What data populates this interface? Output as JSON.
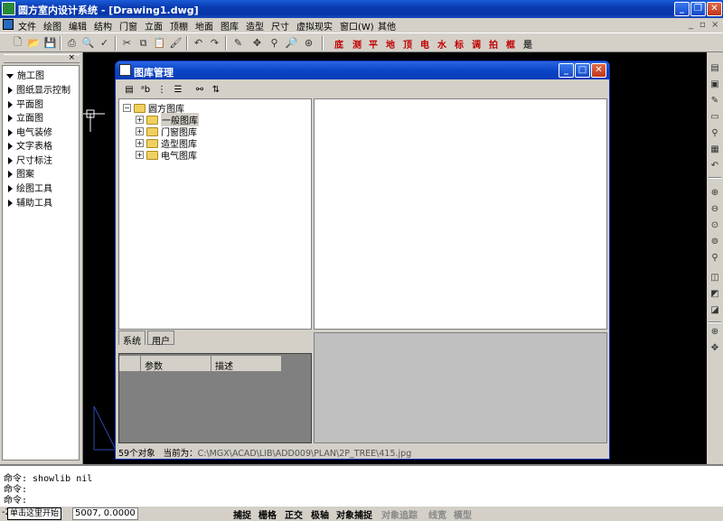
{
  "app": {
    "title": "圆方室内设计系统 - [Drawing1.dwg]"
  },
  "menu": {
    "items": [
      "文件",
      "绘图",
      "编辑",
      "结构",
      "门窗",
      "立面",
      "顶棚",
      "地面",
      "图库",
      "造型",
      "尺寸",
      "虚拟现实",
      "窗口(W)",
      "其他"
    ]
  },
  "toolbar": {
    "red_buttons": [
      "底",
      "测",
      "平",
      "地",
      "顶",
      "电",
      "水",
      "标",
      "调",
      "拍",
      "框",
      "是"
    ]
  },
  "left_panel": {
    "close_label": "×",
    "items": [
      "施工图",
      "图纸显示控制",
      "平面图",
      "立面图",
      "电气装修",
      "文字表格",
      "尺寸标注",
      "图案",
      "绘图工具",
      "辅助工具"
    ]
  },
  "dialog": {
    "title": "图库管理",
    "tree": {
      "root": "圆方图库",
      "children": [
        "一般图库",
        "门窗图库",
        "造型图库",
        "电气图库"
      ]
    },
    "tabs": [
      "系统",
      "用户"
    ],
    "grid_headers": [
      "参数",
      "描述"
    ],
    "status": {
      "count": "59个对象",
      "current_label": "当前为：",
      "path": "C:\\MGX\\ACAD\\LIB\\ADD009\\PLAN\\2P_TREE\\415.jpg"
    }
  },
  "command": {
    "lines": [
      "命令: showlib nil",
      "命令:",
      "命令:"
    ]
  },
  "status_bar": {
    "start": "单击这里开始",
    "prefix": "-2",
    "coords": "5007, 0.0000",
    "toggles": [
      "捕捉",
      "栅格",
      "正交",
      "极轴",
      "对象捕捉",
      "对象追踪",
      "线宽",
      "模型"
    ],
    "toggles_off": [
      false,
      false,
      false,
      false,
      false,
      true,
      true,
      true
    ]
  },
  "colors": {
    "title_blue": "#0a3bb0",
    "red_tool": "#c00000",
    "canvas": "#000000"
  }
}
